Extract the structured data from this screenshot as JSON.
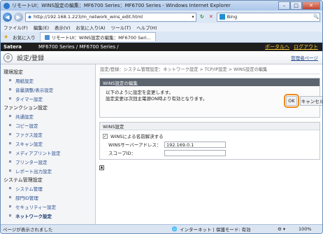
{
  "window": {
    "title": "リモートUI：WINS設定の編集：MF6700 Series：MF6700 Series - Windows Internet Explorer",
    "minimize": "–",
    "maximize": "□",
    "close": "✕"
  },
  "address": {
    "url": "http://192.168.1.223/m_network_wins_edit.html",
    "search_placeholder": "Bing",
    "search_icon": "🔍"
  },
  "menu": [
    "ファイル(F)",
    "編集(E)",
    "表示(V)",
    "お気に入り(A)",
    "ツール(T)",
    "ヘルプ(H)"
  ],
  "favorites": {
    "label": "お気に入り",
    "tab": "リモートUI：WINS設定の編集：MF6700 Seri..."
  },
  "brand": {
    "logo": "Satera",
    "product": "MF6700 Series / MF6700 Series /",
    "portal": "ポータルへ",
    "logout": "ログアウト"
  },
  "page": {
    "title": "設定/登録",
    "admin_link": "管理者ページ"
  },
  "sidebar": {
    "sections": [
      {
        "label": "環境設定",
        "items": [
          "用紙設定",
          "音量調整/表示設定",
          "タイマー設定"
        ]
      },
      {
        "label": "ファンクション設定",
        "items": [
          "共通設定",
          "コピー設定",
          "ファクス設定",
          "スキャン設定",
          "メディアプリント設定",
          "プリンター設定",
          "レポート出力設定"
        ]
      },
      {
        "label": "システム管理設定",
        "items": [
          "システム管理",
          "部門ID管理",
          "セキュリティー設定",
          "ネットワーク設定"
        ]
      }
    ]
  },
  "main": {
    "breadcrumb": "設定/登録：システム管理設定：ネットワーク設定 > TCP/IP設定 > WINS設定の編集",
    "edit_box": {
      "header": "WINS設定の編集",
      "line1": "以下のように設定を変更します。",
      "line2": "設定変更は次回主電源ON時より有効となります。",
      "ok": "OK",
      "cancel": "キャンセル"
    },
    "wins": {
      "header": "WINS設定",
      "resolve_label": "WINSによる名前解決する",
      "resolve_checked": "✓",
      "server_label": "WINSサーバーアドレス：",
      "server_value": "192.169.0.1",
      "scope_label": "スコープID：",
      "scope_value": ""
    },
    "top_icon": "▲"
  },
  "statusbar": {
    "left": "ページが表示されました",
    "zone": "インターネット | 保護モード: 有効",
    "zoom": "100%"
  }
}
